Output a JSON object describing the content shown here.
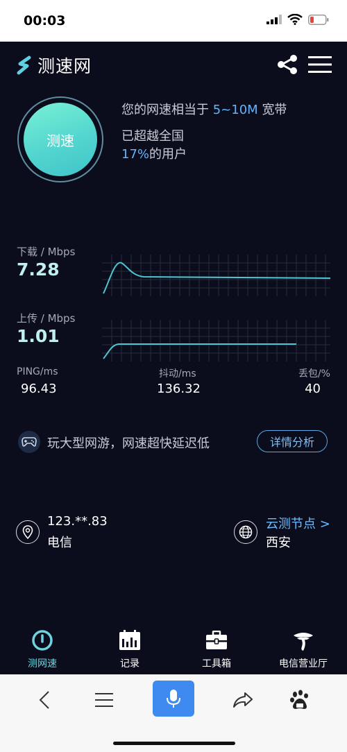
{
  "status": {
    "time": "00:03"
  },
  "app": {
    "name": "测速网"
  },
  "gauge": {
    "label": "测速"
  },
  "summary": {
    "line1_prefix": "您的网速相当于",
    "bandwidth": "5~10M",
    "line1_suffix": "宽带",
    "line2": "已超越全国",
    "percent": "17%",
    "line3_suffix": "的用户"
  },
  "download": {
    "label": "下载 / Mbps",
    "value": "7.28"
  },
  "upload": {
    "label": "上传 / Mbps",
    "value": "1.01"
  },
  "stats": {
    "ping": {
      "label": "PING/ms",
      "value": "96.43"
    },
    "jitter": {
      "label": "抖动/ms",
      "value": "136.32"
    },
    "loss": {
      "label": "丢包/%",
      "value": "40"
    }
  },
  "promo": {
    "text": "玩大型网游，网速超快延迟低",
    "button": "详情分析"
  },
  "location": {
    "ip": "123.**.83",
    "isp": "电信",
    "node_link": "云测节点 >",
    "city": "西安"
  },
  "tabs": [
    {
      "label": "测网速",
      "icon": "speedometer-icon"
    },
    {
      "label": "记录",
      "icon": "calendar-icon"
    },
    {
      "label": "工具箱",
      "icon": "toolbox-icon"
    },
    {
      "label": "电信营业厅",
      "icon": "telecom-logo-icon"
    }
  ],
  "colors": {
    "background": "#0b0d1c",
    "accent": "#60b6ff",
    "gauge": "#53d6cf",
    "graph_line": "#4fc6d3"
  }
}
